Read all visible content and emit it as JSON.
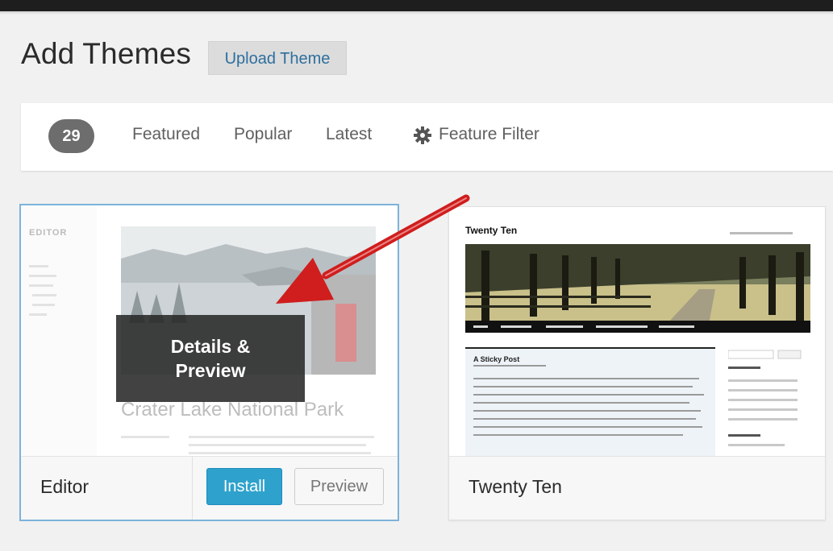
{
  "page": {
    "title": "Add Themes",
    "upload_button": "Upload Theme"
  },
  "filters": {
    "count": "29",
    "links": [
      "Featured",
      "Popular",
      "Latest"
    ],
    "feature_filter": "Feature Filter"
  },
  "themes": [
    {
      "name": "Editor",
      "overlay_line1": "Details &",
      "overlay_line2": "Preview",
      "preview_brand": "EDITOR",
      "preview_post_title": "Crater Lake National Park",
      "install_label": "Install",
      "preview_label": "Preview"
    },
    {
      "name": "Twenty Ten",
      "preview_site_title": "Twenty Ten",
      "preview_post_title": "A Sticky Post"
    }
  ],
  "colors": {
    "accent": "#2ea2cc",
    "selected_border": "#7db3dc",
    "arrow": "#d01d1d"
  }
}
